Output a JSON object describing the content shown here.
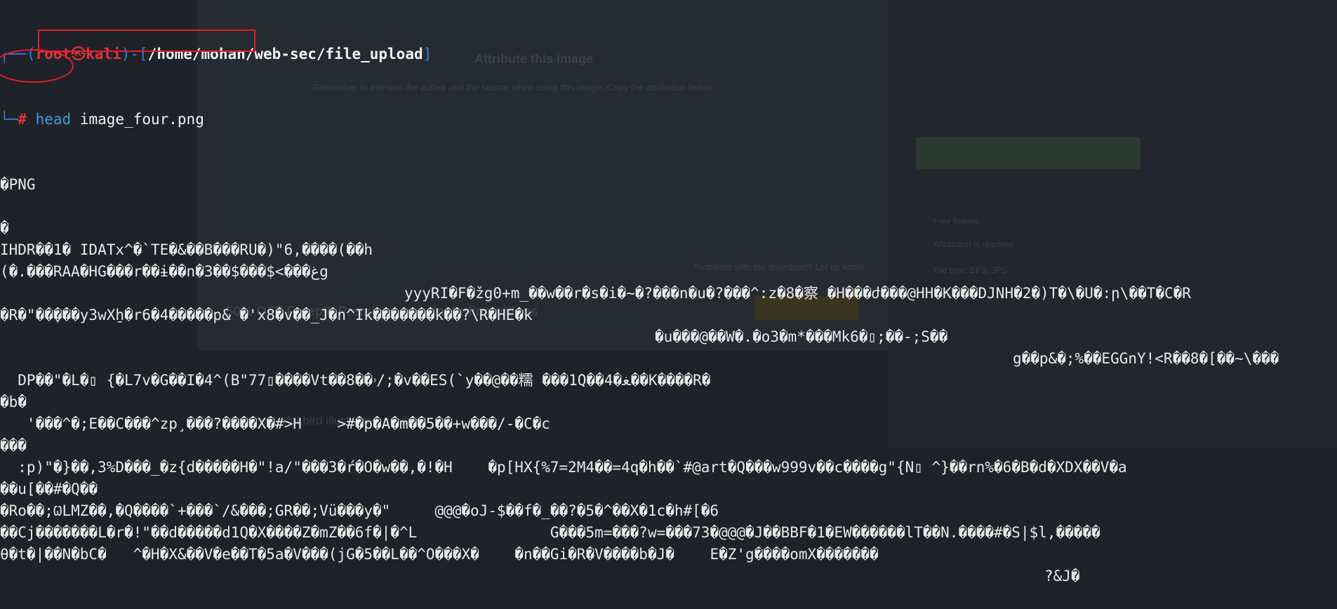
{
  "prompt": {
    "user": "root",
    "host": "kali",
    "path": "/home/mohan/web-sec/file_upload",
    "command": "head",
    "argument": "image_four.png"
  },
  "background": {
    "title": "Attribute this image",
    "description": "Remember to mention the author and the source when using this image. Copy the attribution below",
    "ask": "Problems with the download? Let us know",
    "promo": "50% OFF Freepik Premium, now including videos",
    "caption": "Free vector colorful bird illustration gradient",
    "side_license": "Free license",
    "side_attribution": "Attribution is required",
    "side_filetype": "File type: EPS, JPG"
  },
  "output": [
    {
      "text": "�PNG",
      "indent": 0
    },
    {
      "text": "",
      "indent": 0
    },
    {
      "text": "�",
      "indent": 0
    },
    {
      "text": "IHDR��1� IDATx^�`TE�&��B���RU�)\"6,����(��h",
      "indent": 0
    },
    {
      "text": "(�.���RAA�HG���r��ɨ��n�3��$���$<���ﻍg",
      "indent": 0
    },
    {
      "text": "yyyRI�F�žg0+m_��w��r�s�i�~�?���n�u�?���^:z�8�察 �H���ժ���@HH�K���DJNH�2�)T�\\�U�:ր\\��T�C�R",
      "indent": 576
    },
    {
      "text": "�R�\"��ֶ���y3wXẖ�r6�4�����p& �'x8�v��_J�n^Ik�������k��?\\R�HE�k",
      "indent": 0
    },
    {
      "text": "�u���@��W�.�o3�m*���Mk6�▯;��-;S��",
      "indent": 933
    },
    {
      "text": "g��p&�;%��EGGnY!<R��8�[��~\\���",
      "indent": 1443
    },
    {
      "text": "  DP��\"�L�▯ {�L7v�G��I�4^(B\"77▯����Vt��8��ۥ/;�v��ES(`y��@��糯 ���1Q��4�ﻐ��K����R�",
      "indent": 0
    },
    {
      "text": "�b�",
      "indent": 0
    },
    {
      "text": "   '���^�;E��C���^zp¸���?����X�#>H    >#�p�A�m��5��+w���/-�C�c",
      "indent": 0
    },
    {
      "text": "���",
      "indent": 0
    },
    {
      "text": "  :p)\"�}��,3%D���_�z{d�����H�\"!a/\"���3�ŕ�O�w��,�!�H    �p[HX{%7=2M4��=4q�h��`#@art�Q���w999v��c����g\"{N▯ ^}��rn%�6�B�d�XDX��V�a",
      "indent": 0
    },
    {
      "text": "��u[��#�Q��",
      "indent": 0
    },
    {
      "text": "�Ro��;ѠLMZ��,�Q����`+���`/&���;GR��;Vü���y�\"     @@@�oJ-$��f�_��?�5�^��X�1c�h#[�6",
      "indent": 0
    },
    {
      "text": "��Cj�������L�r�!\"��d�����d1Q�X����Z�mZ��6f�|�^L               G���5m=���?w=���73�@@@�J��BBF�1�EW������lT��N.����#�S|$l,�����",
      "indent": 0
    },
    {
      "text": "θ�t�|��N�bC�   ^�H�X&��V�e��T�5a�V���(jG�5��L��^O���X�    �n��Gi�R�V����b�J�    E�Z'g����omX�������",
      "indent": 0
    },
    {
      "text": "?&J�",
      "indent": 1488
    }
  ]
}
